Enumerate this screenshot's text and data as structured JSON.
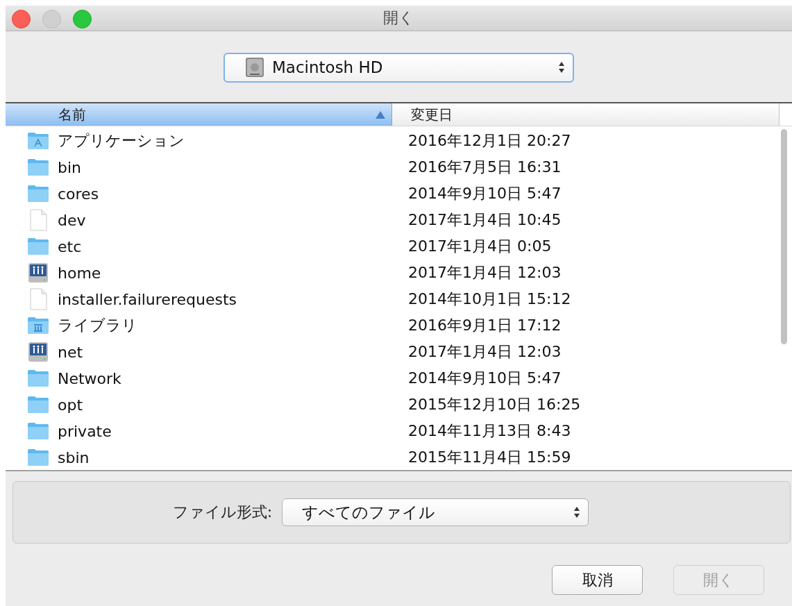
{
  "window": {
    "title": "開く",
    "controls": [
      {
        "kind": "close",
        "disabled": false
      },
      {
        "kind": "minimize",
        "disabled": true
      },
      {
        "kind": "zoom",
        "disabled": false
      }
    ]
  },
  "location": {
    "value": "Macintosh HD"
  },
  "table": {
    "columns": [
      {
        "label": "名前",
        "selected": true,
        "sorted": true
      },
      {
        "label": "変更日",
        "selected": false,
        "sorted": false
      }
    ],
    "rows": [
      {
        "kind": "app-folder",
        "name": "アプリケーション",
        "modified": "2016年12月1日 20:27"
      },
      {
        "kind": "folder",
        "name": "bin",
        "modified": "2016年7月5日 16:31"
      },
      {
        "kind": "folder",
        "name": "cores",
        "modified": "2014年9月10日 5:47"
      },
      {
        "kind": "file",
        "name": "dev",
        "modified": "2017年1月4日 10:45"
      },
      {
        "kind": "folder",
        "name": "etc",
        "modified": "2017年1月4日 0:05"
      },
      {
        "kind": "server",
        "name": "home",
        "modified": "2017年1月4日 12:03"
      },
      {
        "kind": "file",
        "name": "installer.failurerequests",
        "modified": "2014年10月1日 15:12"
      },
      {
        "kind": "library-folder",
        "name": "ライブラリ",
        "modified": "2016年9月1日 17:12"
      },
      {
        "kind": "server",
        "name": "net",
        "modified": "2017年1月4日 12:03"
      },
      {
        "kind": "folder",
        "name": "Network",
        "modified": "2014年9月10日 5:47"
      },
      {
        "kind": "folder",
        "name": "opt",
        "modified": "2015年12月10日 16:25"
      },
      {
        "kind": "folder",
        "name": "private",
        "modified": "2014年11月13日 8:43"
      },
      {
        "kind": "folder",
        "name": "sbin",
        "modified": "2015年11月4日 15:59"
      }
    ]
  },
  "file_format": {
    "label": "ファイル形式:",
    "value": "すべてのファイル"
  },
  "buttons": [
    {
      "label": "取消",
      "disabled": false
    },
    {
      "label": "開く",
      "disabled": true
    }
  ]
}
